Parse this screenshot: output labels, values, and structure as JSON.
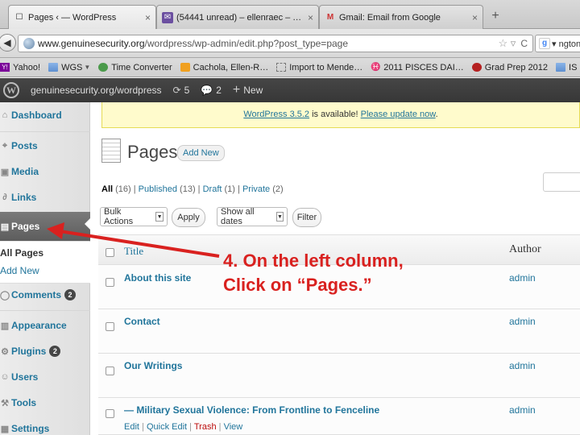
{
  "browser": {
    "tabs": [
      {
        "label": "Pages ‹ — WordPress",
        "close": "×"
      },
      {
        "label": "(54441 unread) – ellenraec – Ya…",
        "close": "×"
      },
      {
        "label": "Gmail: Email from Google",
        "close": "×"
      }
    ],
    "new_tab": "+",
    "url_host": "www.genuinesecurity.org",
    "url_path": "/wordpress/wp-admin/edit.php?post_type=page",
    "search_text": "▾ ngton l"
  },
  "bookmarks": [
    {
      "label": "Yahoo!",
      "icon": "yahoo-icon"
    },
    {
      "label": "WGS",
      "icon": "folder-icon",
      "dropdown": true
    },
    {
      "label": "Time Converter",
      "icon": "clock-icon"
    },
    {
      "label": "Cachola, Ellen-R…",
      "icon": "doc-icon"
    },
    {
      "label": "Import to Mende…",
      "icon": "bookmarklet-icon"
    },
    {
      "label": "2011 PISCES DAI…",
      "icon": "fish-icon"
    },
    {
      "label": "Grad Prep 2012",
      "icon": "apple-icon"
    },
    {
      "label": "IS Stuff",
      "icon": "folder-icon"
    }
  ],
  "adminbar": {
    "site": "genuinesecurity.org/wordpress",
    "updates": "5",
    "comments": "2",
    "new_label": "New"
  },
  "sidebar": {
    "items": [
      {
        "label": "Dashboard",
        "icon": "dashboard-icon"
      },
      {
        "label": "Posts",
        "icon": "pin-icon"
      },
      {
        "label": "Media",
        "icon": "media-icon"
      },
      {
        "label": "Links",
        "icon": "link-icon"
      },
      {
        "label": "Pages",
        "icon": "pages-icon"
      },
      {
        "label": "Comments",
        "icon": "comments-icon",
        "badge": "2"
      },
      {
        "label": "Appearance",
        "icon": "appearance-icon"
      },
      {
        "label": "Plugins",
        "icon": "plugins-icon",
        "badge": "2"
      },
      {
        "label": "Users",
        "icon": "users-icon"
      },
      {
        "label": "Tools",
        "icon": "tools-icon"
      },
      {
        "label": "Settings",
        "icon": "settings-icon"
      }
    ],
    "submenu": [
      "All Pages",
      "Add New"
    ]
  },
  "notice": {
    "version_link": "WordPress 3.5.2",
    "middle": " is available! ",
    "update_link": "Please update now",
    "end": "."
  },
  "main": {
    "title": "Pages",
    "add_new": "Add New",
    "filters": {
      "all": "All",
      "all_count": " (16)",
      "published": "Published",
      "published_count": " (13)",
      "draft": "Draft",
      "draft_count": " (1)",
      "private": "Private",
      "private_count": " (2)",
      "sep": " | "
    },
    "bulk_actions": "Bulk Actions",
    "apply": "Apply",
    "dates": "Show all dates",
    "filter": "Filter",
    "columns": {
      "title": "Title",
      "author": "Author"
    },
    "rows": [
      {
        "title": "About this site",
        "author": "admin"
      },
      {
        "title": "Contact",
        "author": "admin"
      },
      {
        "title": "Our Writings",
        "author": "admin"
      },
      {
        "title": "— Military Sexual Violence: From Frontline to Fenceline",
        "author": "admin"
      }
    ],
    "row_actions": {
      "edit": "Edit",
      "quick_edit": "Quick Edit",
      "trash": "Trash",
      "view": "View",
      "sep": " | "
    }
  },
  "annotation": {
    "line1": "4. On the left column,",
    "line2": "Click on “Pages.”",
    "color": "#d9211f"
  },
  "colors": {
    "link": "#21759b",
    "adminbar": "#464646",
    "notice": "#fffbcc",
    "current_menu": "#6d6d6d"
  }
}
